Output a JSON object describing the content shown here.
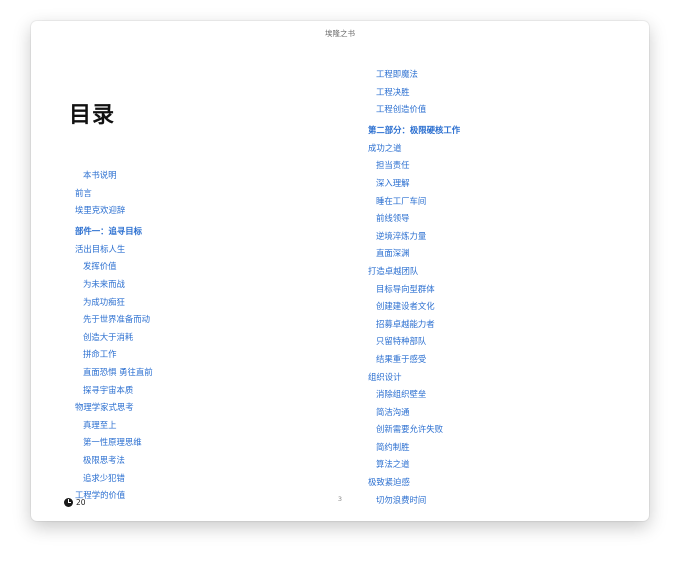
{
  "window": {
    "title": "埃隆之书"
  },
  "page": {
    "heading": "目录",
    "page_number": "3"
  },
  "footer": {
    "time_icon": "clock-icon",
    "remaining": "20"
  },
  "colors": {
    "link": "#2b6fd0",
    "heading": "#111111"
  },
  "toc": {
    "left": [
      {
        "label": "本书说明",
        "level": 2
      },
      {
        "label": "前言",
        "level": 1
      },
      {
        "label": "埃里克欢迎辞",
        "level": 1
      },
      {
        "label": "部件一：追寻目标",
        "level": 0
      },
      {
        "label": "活出目标人生",
        "level": 1
      },
      {
        "label": "发挥价值",
        "level": 2
      },
      {
        "label": "为未来而战",
        "level": 2
      },
      {
        "label": "为成功痴狂",
        "level": 2
      },
      {
        "label": "先于世界准备而动",
        "level": 2
      },
      {
        "label": "创造大于消耗",
        "level": 2
      },
      {
        "label": "拼命工作",
        "level": 2
      },
      {
        "label": "直面恐惧 勇往直前",
        "level": 2
      },
      {
        "label": "探寻宇宙本质",
        "level": 2
      },
      {
        "label": "物理学家式思考",
        "level": 1
      },
      {
        "label": "真理至上",
        "level": 2
      },
      {
        "label": "第一性原理思维",
        "level": 2
      },
      {
        "label": "极限思考法",
        "level": 2
      },
      {
        "label": "追求少犯错",
        "level": 2
      },
      {
        "label": "工程学的价值",
        "level": 1
      }
    ],
    "right": [
      {
        "label": "工程即魔法",
        "level": 2
      },
      {
        "label": "工程决胜",
        "level": 2
      },
      {
        "label": "工程创造价值",
        "level": 2
      },
      {
        "label": "第二部分：极限硬核工作",
        "level": 0
      },
      {
        "label": "成功之道",
        "level": 1
      },
      {
        "label": "担当责任",
        "level": 2
      },
      {
        "label": "深入理解",
        "level": 2
      },
      {
        "label": "睡在工厂车间",
        "level": 2
      },
      {
        "label": "前线领导",
        "level": 2
      },
      {
        "label": "逆境淬炼力量",
        "level": 2
      },
      {
        "label": "直面深渊",
        "level": 2
      },
      {
        "label": "打造卓越团队",
        "level": 1
      },
      {
        "label": "目标导向型群体",
        "level": 2
      },
      {
        "label": "创建建设者文化",
        "level": 2
      },
      {
        "label": "招募卓越能力者",
        "level": 2
      },
      {
        "label": "只留特种部队",
        "level": 2
      },
      {
        "label": "结果重于感受",
        "level": 2
      },
      {
        "label": "组织设计",
        "level": 1
      },
      {
        "label": "消除组织壁垒",
        "level": 2
      },
      {
        "label": "简洁沟通",
        "level": 2
      },
      {
        "label": "创新需要允许失败",
        "level": 2
      },
      {
        "label": "简约制胜",
        "level": 2
      },
      {
        "label": "算法之道",
        "level": 2
      },
      {
        "label": "极致紧迫感",
        "level": 1
      },
      {
        "label": "切勿浪费时间",
        "level": 2
      }
    ]
  }
}
